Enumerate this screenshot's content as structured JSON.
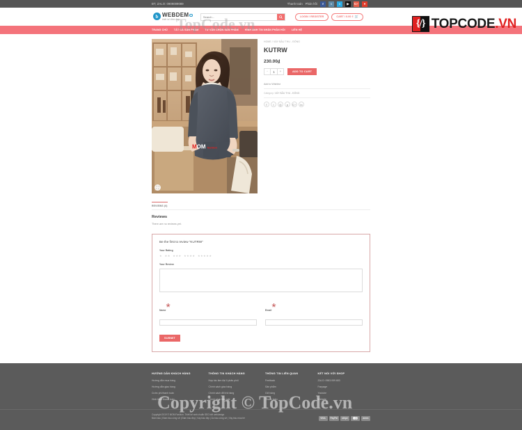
{
  "topbar": {
    "phone": "ĐT, ZALO: 0909009089",
    "links": [
      "Thanh toán",
      "Phản hồi"
    ],
    "socials": [
      "facebook-icon",
      "tumblr-icon",
      "twitter-icon",
      "youtube-icon",
      "google-plus-icon",
      "rss-icon"
    ],
    "social_glyphs": [
      "f",
      "t",
      "t",
      "▶",
      "G+",
      "●"
    ]
  },
  "header": {
    "logo_main": "WEBDEM",
    "logo_sub": "thiết kế Web đẹp",
    "search_placeholder": "Search...",
    "search_value": "",
    "login_label": "LOGIN / REGISTER",
    "cart_label": "CART / 0.00 ₫",
    "brand_badge": "{/}",
    "brand_text_black": "TOPCODE",
    "brand_text_red": ".VN"
  },
  "nav": {
    "items": [
      "TRANG CHỦ",
      "TẤT CẢ SẢN PHẨM",
      "TƯ VẤN CHỌN SẢN PHẨM",
      "HÌNH ẢNH TIN NHẮN PHẢN HỒI",
      "LIÊN HỆ"
    ]
  },
  "product": {
    "breadcrumb": "HOME / VÁY BẦU THU - ĐÔNG",
    "title": "KUTRW",
    "price": "230.00",
    "currency": "₫",
    "qty_value": "1",
    "qty_minus": "-",
    "qty_plus": "+",
    "add_to_cart": "ADD TO CART",
    "wishlist": "Add to Wishlist",
    "category_label": "Category:",
    "category_value": "VÁY BẦU THU - ĐÔNG",
    "share_icons": [
      "facebook-icon",
      "twitter-icon",
      "instagram-icon",
      "pinterest-icon",
      "google-plus-icon",
      "linkedin-icon"
    ],
    "share_glyphs": [
      "f",
      "t",
      "◎",
      "p",
      "G+",
      "in"
    ],
    "image_watermark_main": "M",
    "image_watermark_rest": "OM",
    "image_watermark_brand": "fashion",
    "zoom_icon": "⛶"
  },
  "reviews": {
    "tab_label": "REVIEWS (0)",
    "heading": "Reviews",
    "empty_text": "There are no reviews yet.",
    "form": {
      "title": "Be the first to review “KUTRW”",
      "rating_label": "Your Rating",
      "star_groups": [
        1,
        2,
        3,
        4,
        5
      ],
      "star_glyph": "★",
      "review_label": "Your Review",
      "review_value": "",
      "name_label": "Name",
      "name_value": "",
      "email_label": "Email",
      "email_value": "",
      "required_mark": "*",
      "submit_label": "SUBMIT"
    }
  },
  "footer": {
    "columns": [
      {
        "title": "HƯỚNG DẪN KHÁCH HÀNG",
        "items": [
          "Hướng dẫn mua hàng",
          "Hướng dẫn giao hàng",
          "Cước phí thanh toán",
          "Hình thức thanh toán"
        ]
      },
      {
        "title": "THÔNG TIN KHÁCH HÀNG",
        "items": [
          "Hợp tác làm đại lí phân phối",
          "Chính sách giao hàng",
          "Chính sách đổi trả hàng",
          "Chính sách bảo mật"
        ]
      },
      {
        "title": "THÔNG TIN LIÊN QUAN",
        "items": [
          "Feetback",
          "Sản phẩm",
          "Giỏ hàng",
          "Thanh toán"
        ]
      },
      {
        "title": "KẾT NỐI VỚI SHOP",
        "items": [
          "ZALO: 0983.059.683",
          "Fanpage",
          "Youtube",
          "Website"
        ]
      }
    ],
    "copyright": "Copyright 2019 © MOM Fashion. Thiết kế web chuẩn SEO bởi webdesign",
    "tags": "Đầm bầu | Đầm bầu công sở | Đầm bầu đẹp | Váy bầu đẹp | Áo bầu công sở | Váy bầu mùa hè",
    "payments": [
      "VISA",
      "PayPal",
      "stripe",
      "mastercard-icon",
      "amex"
    ]
  },
  "watermark": {
    "top": "TopCode.vn",
    "bottom": "Copyright © TopCode.vn"
  }
}
